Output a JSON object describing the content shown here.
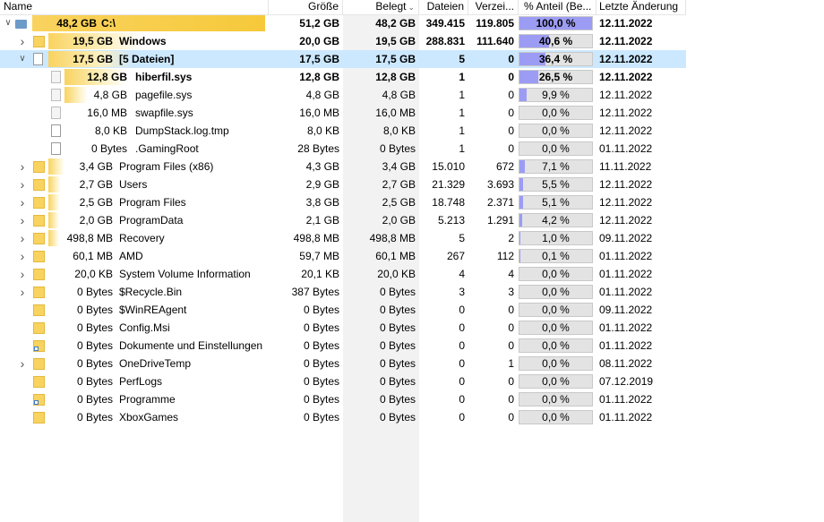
{
  "header": {
    "name": "Name",
    "groesse": "Größe",
    "belegt": "Belegt",
    "dateien": "Dateien",
    "verzeichnisse": "Verzei...",
    "anteil": "% Anteil (Be...",
    "datum": "Letzte Änderung"
  },
  "colors": {
    "selected": "#cce8ff",
    "bar_gold": "#f9d35f",
    "bar_fade": "#fdf0c0",
    "pct_fill": "#9c9cf4",
    "pct_bg": "#e3e3e3"
  },
  "rows": [
    {
      "level": 0,
      "expander": "open",
      "icon": "drive",
      "size": "48,2 GB",
      "name": "C:\\",
      "groesse": "51,2 GB",
      "belegt": "48,2 GB",
      "dateien": "349.415",
      "verz": "119.805",
      "anteil": "100,0 %",
      "pct": 100.0,
      "datum": "12.11.2022",
      "bold": true
    },
    {
      "level": 1,
      "expander": "closed",
      "icon": "folder",
      "size": "19,5 GB",
      "name": "Windows",
      "groesse": "20,0 GB",
      "belegt": "19,5 GB",
      "dateien": "288.831",
      "verz": "111.640",
      "anteil": "40,6 %",
      "pct": 40.6,
      "datum": "12.11.2022",
      "bold": true
    },
    {
      "level": 1,
      "expander": "open",
      "icon": "file",
      "size": "17,5 GB",
      "name": "[5 Dateien]",
      "groesse": "17,5 GB",
      "belegt": "17,5 GB",
      "dateien": "5",
      "verz": "0",
      "anteil": "36,4 %",
      "pct": 36.4,
      "datum": "12.11.2022",
      "bold": true,
      "selected": true
    },
    {
      "level": 2,
      "expander": "",
      "icon": "sysfile",
      "size": "12,8 GB",
      "name": "hiberfil.sys",
      "groesse": "12,8 GB",
      "belegt": "12,8 GB",
      "dateien": "1",
      "verz": "0",
      "anteil": "26,5 %",
      "pct": 26.5,
      "datum": "12.11.2022",
      "bold": true
    },
    {
      "level": 2,
      "expander": "",
      "icon": "sysfile",
      "size": "4,8 GB",
      "name": "pagefile.sys",
      "groesse": "4,8 GB",
      "belegt": "4,8 GB",
      "dateien": "1",
      "verz": "0",
      "anteil": "9,9 %",
      "pct": 9.9,
      "datum": "12.11.2022"
    },
    {
      "level": 2,
      "expander": "",
      "icon": "sysfile",
      "size": "16,0 MB",
      "name": "swapfile.sys",
      "groesse": "16,0 MB",
      "belegt": "16,0 MB",
      "dateien": "1",
      "verz": "0",
      "anteil": "0,0 %",
      "pct": 0.0,
      "datum": "12.11.2022"
    },
    {
      "level": 2,
      "expander": "",
      "icon": "file",
      "size": "8,0 KB",
      "name": "DumpStack.log.tmp",
      "groesse": "8,0 KB",
      "belegt": "8,0 KB",
      "dateien": "1",
      "verz": "0",
      "anteil": "0,0 %",
      "pct": 0.0,
      "datum": "12.11.2022"
    },
    {
      "level": 2,
      "expander": "",
      "icon": "file",
      "size": "0 Bytes",
      "name": ".GamingRoot",
      "groesse": "28 Bytes",
      "belegt": "0 Bytes",
      "dateien": "1",
      "verz": "0",
      "anteil": "0,0 %",
      "pct": 0.0,
      "datum": "01.11.2022"
    },
    {
      "level": 1,
      "expander": "closed",
      "icon": "folder",
      "size": "3,4 GB",
      "name": "Program Files (x86)",
      "groesse": "4,3 GB",
      "belegt": "3,4 GB",
      "dateien": "15.010",
      "verz": "672",
      "anteil": "7,1 %",
      "pct": 7.1,
      "datum": "11.11.2022"
    },
    {
      "level": 1,
      "expander": "closed",
      "icon": "folder",
      "size": "2,7 GB",
      "name": "Users",
      "groesse": "2,9 GB",
      "belegt": "2,7 GB",
      "dateien": "21.329",
      "verz": "3.693",
      "anteil": "5,5 %",
      "pct": 5.5,
      "datum": "12.11.2022"
    },
    {
      "level": 1,
      "expander": "closed",
      "icon": "folder",
      "size": "2,5 GB",
      "name": "Program Files",
      "groesse": "3,8 GB",
      "belegt": "2,5 GB",
      "dateien": "18.748",
      "verz": "2.371",
      "anteil": "5,1 %",
      "pct": 5.1,
      "datum": "12.11.2022"
    },
    {
      "level": 1,
      "expander": "closed",
      "icon": "folder",
      "size": "2,0 GB",
      "name": "ProgramData",
      "groesse": "2,1 GB",
      "belegt": "2,0 GB",
      "dateien": "5.213",
      "verz": "1.291",
      "anteil": "4,2 %",
      "pct": 4.2,
      "datum": "12.11.2022"
    },
    {
      "level": 1,
      "expander": "closed",
      "icon": "folder",
      "size": "498,8 MB",
      "name": "Recovery",
      "groesse": "498,8 MB",
      "belegt": "498,8 MB",
      "dateien": "5",
      "verz": "2",
      "anteil": "1,0 %",
      "pct": 1.0,
      "datum": "09.11.2022"
    },
    {
      "level": 1,
      "expander": "closed",
      "icon": "folder",
      "size": "60,1 MB",
      "name": "AMD",
      "groesse": "59,7 MB",
      "belegt": "60,1 MB",
      "dateien": "267",
      "verz": "112",
      "anteil": "0,1 %",
      "pct": 0.1,
      "datum": "01.11.2022"
    },
    {
      "level": 1,
      "expander": "closed",
      "icon": "folder",
      "size": "20,0 KB",
      "name": "System Volume Information",
      "groesse": "20,1 KB",
      "belegt": "20,0 KB",
      "dateien": "4",
      "verz": "4",
      "anteil": "0,0 %",
      "pct": 0.0,
      "datum": "01.11.2022"
    },
    {
      "level": 1,
      "expander": "closed",
      "icon": "folder",
      "size": "0 Bytes",
      "name": "$Recycle.Bin",
      "groesse": "387 Bytes",
      "belegt": "0 Bytes",
      "dateien": "3",
      "verz": "3",
      "anteil": "0,0 %",
      "pct": 0.0,
      "datum": "01.11.2022"
    },
    {
      "level": 1,
      "expander": "",
      "icon": "folder",
      "size": "0 Bytes",
      "name": "$WinREAgent",
      "groesse": "0 Bytes",
      "belegt": "0 Bytes",
      "dateien": "0",
      "verz": "0",
      "anteil": "0,0 %",
      "pct": 0.0,
      "datum": "09.11.2022"
    },
    {
      "level": 1,
      "expander": "",
      "icon": "folder",
      "size": "0 Bytes",
      "name": "Config.Msi",
      "groesse": "0 Bytes",
      "belegt": "0 Bytes",
      "dateien": "0",
      "verz": "0",
      "anteil": "0,0 %",
      "pct": 0.0,
      "datum": "01.11.2022"
    },
    {
      "level": 1,
      "expander": "",
      "icon": "shortcut-folder",
      "size": "0 Bytes",
      "name": "Dokumente und Einstellungen",
      "groesse": "0 Bytes",
      "belegt": "0 Bytes",
      "dateien": "0",
      "verz": "0",
      "anteil": "0,0 %",
      "pct": 0.0,
      "datum": "01.11.2022"
    },
    {
      "level": 1,
      "expander": "closed",
      "icon": "folder",
      "size": "0 Bytes",
      "name": "OneDriveTemp",
      "groesse": "0 Bytes",
      "belegt": "0 Bytes",
      "dateien": "0",
      "verz": "1",
      "anteil": "0,0 %",
      "pct": 0.0,
      "datum": "08.11.2022"
    },
    {
      "level": 1,
      "expander": "",
      "icon": "folder",
      "size": "0 Bytes",
      "name": "PerfLogs",
      "groesse": "0 Bytes",
      "belegt": "0 Bytes",
      "dateien": "0",
      "verz": "0",
      "anteil": "0,0 %",
      "pct": 0.0,
      "datum": "07.12.2019"
    },
    {
      "level": 1,
      "expander": "",
      "icon": "shortcut-folder",
      "size": "0 Bytes",
      "name": "Programme",
      "groesse": "0 Bytes",
      "belegt": "0 Bytes",
      "dateien": "0",
      "verz": "0",
      "anteil": "0,0 %",
      "pct": 0.0,
      "datum": "01.11.2022"
    },
    {
      "level": 1,
      "expander": "",
      "icon": "folder",
      "size": "0 Bytes",
      "name": "XboxGames",
      "groesse": "0 Bytes",
      "belegt": "0 Bytes",
      "dateien": "0",
      "verz": "0",
      "anteil": "0,0 %",
      "pct": 0.0,
      "datum": "01.11.2022"
    }
  ]
}
